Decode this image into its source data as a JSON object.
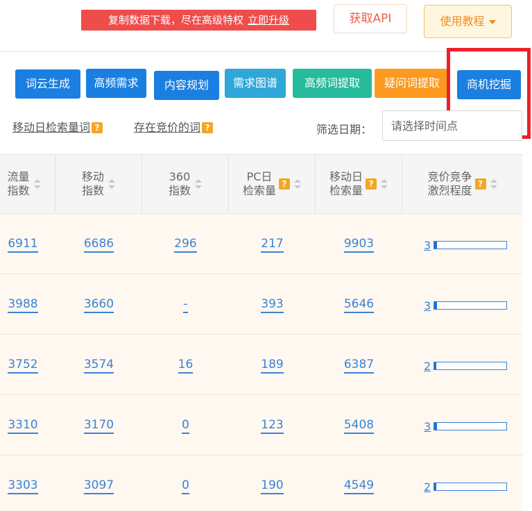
{
  "topbar": {
    "promo_text": "复制数据下载，尽在高级特权",
    "promo_link": "立即升级",
    "api_label": "获取API",
    "tutorial_label": "使用教程"
  },
  "tools": [
    {
      "label": "词云生成",
      "color": "#1a7fe0"
    },
    {
      "label": "高频需求",
      "color": "#1a7fe0"
    },
    {
      "label": "内容规划",
      "color": "#1a7fe0"
    },
    {
      "label": "需求图谱",
      "color": "#2fa7d8"
    },
    {
      "label": "高频词提取",
      "color": "#25bb9b"
    },
    {
      "label": "疑问词提取",
      "color": "#fb9a1e"
    },
    {
      "label": "商机挖掘",
      "color": "#1a7fe0"
    }
  ],
  "filters": {
    "mobile_search_link": "移动日检索量词",
    "bid_words_link": "存在竞价的词",
    "date_label": "筛选日期：",
    "date_placeholder": "请选择时间点"
  },
  "table": {
    "headers": [
      "流量指数",
      "移动指数",
      "360指数",
      "PC日检索量",
      "移动日检索量",
      "竞价竞争激烈程度"
    ],
    "header_lines": [
      [
        "流量",
        "指数"
      ],
      [
        "移动",
        "指数"
      ],
      [
        "360",
        "指数"
      ],
      [
        "PC日",
        "检索量"
      ],
      [
        "移动日",
        "检索量"
      ],
      [
        "竞价竞争",
        "激烈程度"
      ]
    ],
    "rows": [
      {
        "traffic": "6911",
        "mobile": "6686",
        "idx360": "296",
        "pc_daily": "217",
        "mobile_daily": "9903",
        "competition": "3",
        "competition_level": 0.04
      },
      {
        "traffic": "3988",
        "mobile": "3660",
        "idx360": "-",
        "pc_daily": "393",
        "mobile_daily": "5646",
        "competition": "3",
        "competition_level": 0.04
      },
      {
        "traffic": "3752",
        "mobile": "3574",
        "idx360": "16",
        "pc_daily": "189",
        "mobile_daily": "6387",
        "competition": "2",
        "competition_level": 0.03
      },
      {
        "traffic": "3310",
        "mobile": "3170",
        "idx360": "0",
        "pc_daily": "123",
        "mobile_daily": "5408",
        "competition": "3",
        "competition_level": 0.04
      },
      {
        "traffic": "3303",
        "mobile": "3097",
        "idx360": "0",
        "pc_daily": "190",
        "mobile_daily": "4549",
        "competition": "2",
        "competition_level": 0.03
      }
    ]
  },
  "colors": {
    "link_blue": "#3a82d6",
    "highlight_red": "#ee1f2a",
    "promo_red": "#ef4c4c",
    "help_orange": "#f5a623"
  }
}
